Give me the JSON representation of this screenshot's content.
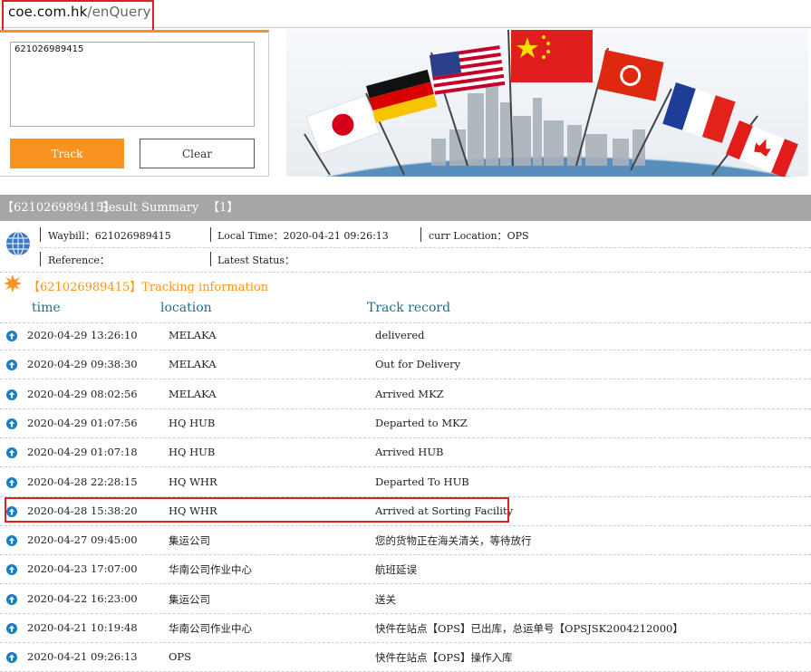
{
  "browser": {
    "url_host": "coe.com.hk",
    "url_path": "/enQuery"
  },
  "search": {
    "input_value": "621026989415",
    "track_label": "Track",
    "clear_label": "Clear"
  },
  "summary": {
    "waybill_tag": "【621026989415】",
    "title": "Result Summary",
    "count": "【1】"
  },
  "info": {
    "waybill_label": "Waybill：",
    "waybill_value": "621026989415",
    "local_time_label": "Local Time：",
    "local_time_value": "2020-04-21 09:26:13",
    "curr_location_label": "curr Location：",
    "curr_location_value": "OPS",
    "reference_label": "Reference：",
    "latest_status_label": "Latest Status："
  },
  "tracking": {
    "title": "【621026989415】Tracking information",
    "headers": [
      "time",
      "location",
      "Track record"
    ],
    "rows": [
      {
        "time": "2020-04-29 13:26:10",
        "location": "MELAKA",
        "record": "delivered"
      },
      {
        "time": "2020-04-29 09:38:30",
        "location": "MELAKA",
        "record": "Out for Delivery"
      },
      {
        "time": "2020-04-29 08:02:56",
        "location": "MELAKA",
        "record": "Arrived MKZ"
      },
      {
        "time": "2020-04-29 01:07:56",
        "location": "HQ HUB",
        "record": "Departed to MKZ"
      },
      {
        "time": "2020-04-29 01:07:18",
        "location": "HQ HUB",
        "record": "Arrived HUB"
      },
      {
        "time": "2020-04-28 22:28:15",
        "location": "HQ WHR",
        "record": "Departed To HUB"
      },
      {
        "time": "2020-04-28 15:38:20",
        "location": "HQ WHR",
        "record": "Arrived at Sorting Facility"
      },
      {
        "time": "2020-04-27 09:45:00",
        "location": "集运公司",
        "record": "您的货物正在海关清关，等待放行"
      },
      {
        "time": "2020-04-23 17:07:00",
        "location": "华南公司作业中心",
        "record": "航班延误"
      },
      {
        "time": "2020-04-22 16:23:00",
        "location": "集运公司",
        "record": "送关"
      },
      {
        "time": "2020-04-21 10:19:48",
        "location": "华南公司作业中心",
        "record": "快件在站点【OPS】已出库，总运单号【OPSJSK2004212000】"
      },
      {
        "time": "2020-04-21 09:26:13",
        "location": "OPS",
        "record": "快件在站点【OPS】操作入库"
      }
    ]
  },
  "colors": {
    "accent": "#f7931e",
    "header_bar": "#a6a6a6",
    "column_header": "#1f6e8c",
    "annotation": "#e02020",
    "row_arrow": "#1a7fc1"
  }
}
